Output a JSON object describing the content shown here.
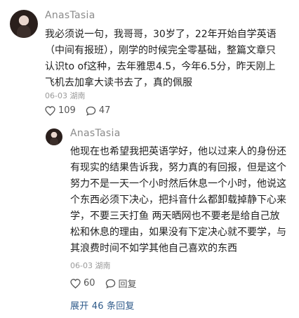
{
  "comment": {
    "username": "AnasTasia",
    "text": "我必须说一句，我哥哥，30岁了，22年开始自学英语（中间有报班），刚学的时候完全零基础，整篇文章只认识to of这种，去年雅思4.5，今年6.5分，昨天刚上飞机去加拿大读书去了，真的佩服",
    "meta": "06-03 湖南",
    "likes": "109",
    "replies": "47"
  },
  "reply": {
    "username": "AnasTasia",
    "text": "他现在也希望我把英语学好，他以过来人的身份还有现实的结果告诉我，努力真的有回报，但是这个努力不是一天一个小时然后休息一个小时，他说这个东西必须下决心，把抖音什么都卸载掉静下心来学，不要三天打鱼 两天晒网也不要老是给自己放松和休息的理由，如果没有下定决心就不要学，与其浪费时间不如学其他自己喜欢的东西",
    "meta": "06-03 湖南",
    "likes": "60",
    "reply_label": "回复"
  },
  "expand_label": "展开 46 条回复"
}
